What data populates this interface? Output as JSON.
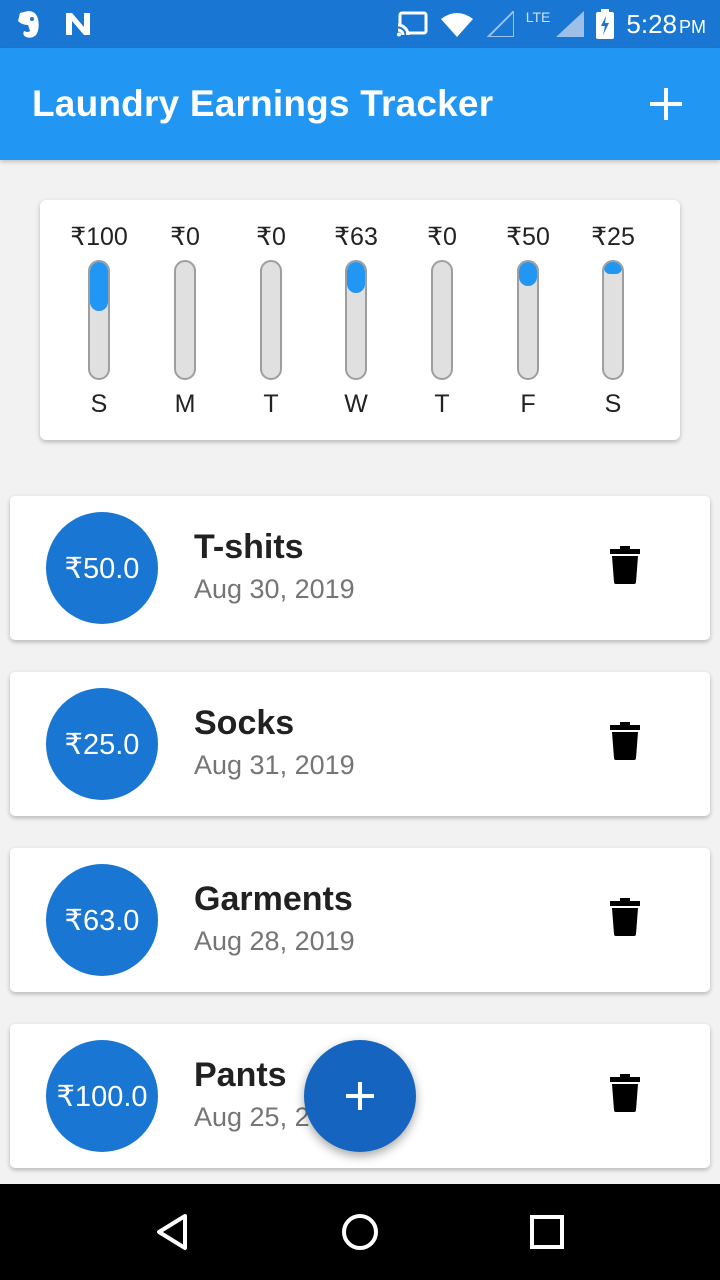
{
  "status_bar": {
    "time": "5:28",
    "ampm": "PM",
    "network": "LTE",
    "icons": [
      "evernote-icon",
      "n-notification-icon",
      "cast-icon",
      "wifi-icon",
      "signal-icon",
      "battery-charging-icon"
    ]
  },
  "app_bar": {
    "title": "Laundry Earnings Tracker",
    "add_icon": "plus-icon"
  },
  "weekly_chart": {
    "days": [
      {
        "label": "S",
        "amount": "₹100",
        "value": 100
      },
      {
        "label": "M",
        "amount": "₹0",
        "value": 0
      },
      {
        "label": "T",
        "amount": "₹0",
        "value": 0
      },
      {
        "label": "W",
        "amount": "₹63",
        "value": 63
      },
      {
        "label": "T",
        "amount": "₹0",
        "value": 0
      },
      {
        "label": "F",
        "amount": "₹50",
        "value": 50
      },
      {
        "label": "S",
        "amount": "₹25",
        "value": 25
      }
    ],
    "max_value": 238,
    "fill_color": "#2196f3"
  },
  "entries": [
    {
      "amount": "₹50.0",
      "name": "T-shits",
      "date": "Aug 30, 2019"
    },
    {
      "amount": "₹25.0",
      "name": "Socks",
      "date": "Aug 31, 2019"
    },
    {
      "amount": "₹63.0",
      "name": "Garments",
      "date": "Aug 28, 2019"
    },
    {
      "amount": "₹100.0",
      "name": "Pants",
      "date": "Aug 25, 2019"
    }
  ],
  "fab": {
    "icon": "plus-icon"
  },
  "nav_bar": {
    "icons": [
      "back-icon",
      "home-icon",
      "recents-icon"
    ]
  },
  "colors": {
    "status_bar": "#1976d2",
    "app_bar": "#2196f3",
    "circle": "#1976d2",
    "fab": "#1565c0"
  }
}
